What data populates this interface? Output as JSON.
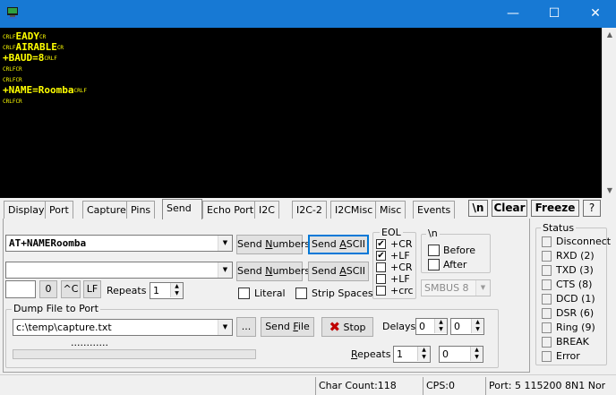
{
  "window": {
    "minimize_glyph": "—",
    "maximize_glyph": "☐",
    "close_glyph": "✕",
    "titlebar_color": "#1779d4"
  },
  "terminal": {
    "text_color": "#ffff00",
    "background": "#000000",
    "lines": [
      {
        "pre": "CRLF",
        "text": "EADY",
        "post": "CR"
      },
      {
        "pre": "CRLF",
        "text": "AIRABLE",
        "post": "CR"
      },
      {
        "pre": "",
        "text": "+BAUD=8",
        "post": "CRLF"
      },
      {
        "pre": "CRLFCR",
        "text": "",
        "post": ""
      },
      {
        "pre": "CRLFCR",
        "text": "",
        "post": ""
      },
      {
        "pre": "",
        "text": "+NAME=Roomba",
        "post": "CRLF"
      },
      {
        "pre": "CRLFCR",
        "text": "",
        "post": ""
      }
    ]
  },
  "tabs": [
    "Display",
    "Port",
    "Capture",
    "Pins",
    "Send",
    "Echo Port",
    "I2C",
    "I2C-2",
    "I2CMisc",
    "Misc",
    "Events"
  ],
  "active_tab": "Send",
  "toolbar": {
    "newline_btn": "\\n",
    "clear_btn": "Clear",
    "freeze_btn": "Freeze",
    "help_btn": "?"
  },
  "send": {
    "line1_value": "AT+NAMERoomba",
    "line2_value": "",
    "send_numbers_pre": "Send ",
    "send_numbers_u": "N",
    "send_numbers_post": "umbers",
    "send_ascii_pre": "Send ",
    "send_ascii_u": "A",
    "send_ascii_post": "SCII",
    "small_value": "",
    "zero_btn": "0",
    "ctrl_c_btn": "^C",
    "lf_btn": "LF",
    "repeats_label": "Repeats",
    "repeats_value": "1",
    "literal_label": "Literal",
    "strip_spaces_label": "Strip Spaces"
  },
  "eol": {
    "title": "EOL",
    "items": [
      {
        "label": "+CR",
        "checked": "✔"
      },
      {
        "label": "+LF",
        "checked": "✔"
      },
      {
        "label": "+CR",
        "checked": ""
      },
      {
        "label": "+LF",
        "checked": ""
      },
      {
        "label": "+crc",
        "checked": ""
      }
    ]
  },
  "newline_group": {
    "title": "\\n",
    "before_label": "Before",
    "after_label": "After"
  },
  "smbus": {
    "value": "SMBUS 8"
  },
  "dump": {
    "title": "Dump File to Port",
    "path": "c:\\temp\\capture.txt",
    "browse_btn": "...",
    "send_file_pre": "Send ",
    "send_file_u": "F",
    "send_file_post": "ile",
    "stop_label": "Stop",
    "progress_text": "............",
    "delays_label": "Delays",
    "delay1": "0",
    "delay2": "0",
    "repeats_label": "Repeats",
    "repeats1": "1",
    "repeats2": "0"
  },
  "status": {
    "title": "Status",
    "items": [
      "Disconnect",
      "RXD (2)",
      "TXD (3)",
      "CTS (8)",
      "DCD (1)",
      "DSR (6)",
      "Ring (9)",
      "BREAK",
      "Error"
    ]
  },
  "statusbar": {
    "char_count": "Char Count:118",
    "cps": "CPS:0",
    "port": "Port: 5 115200 8N1 Non"
  }
}
